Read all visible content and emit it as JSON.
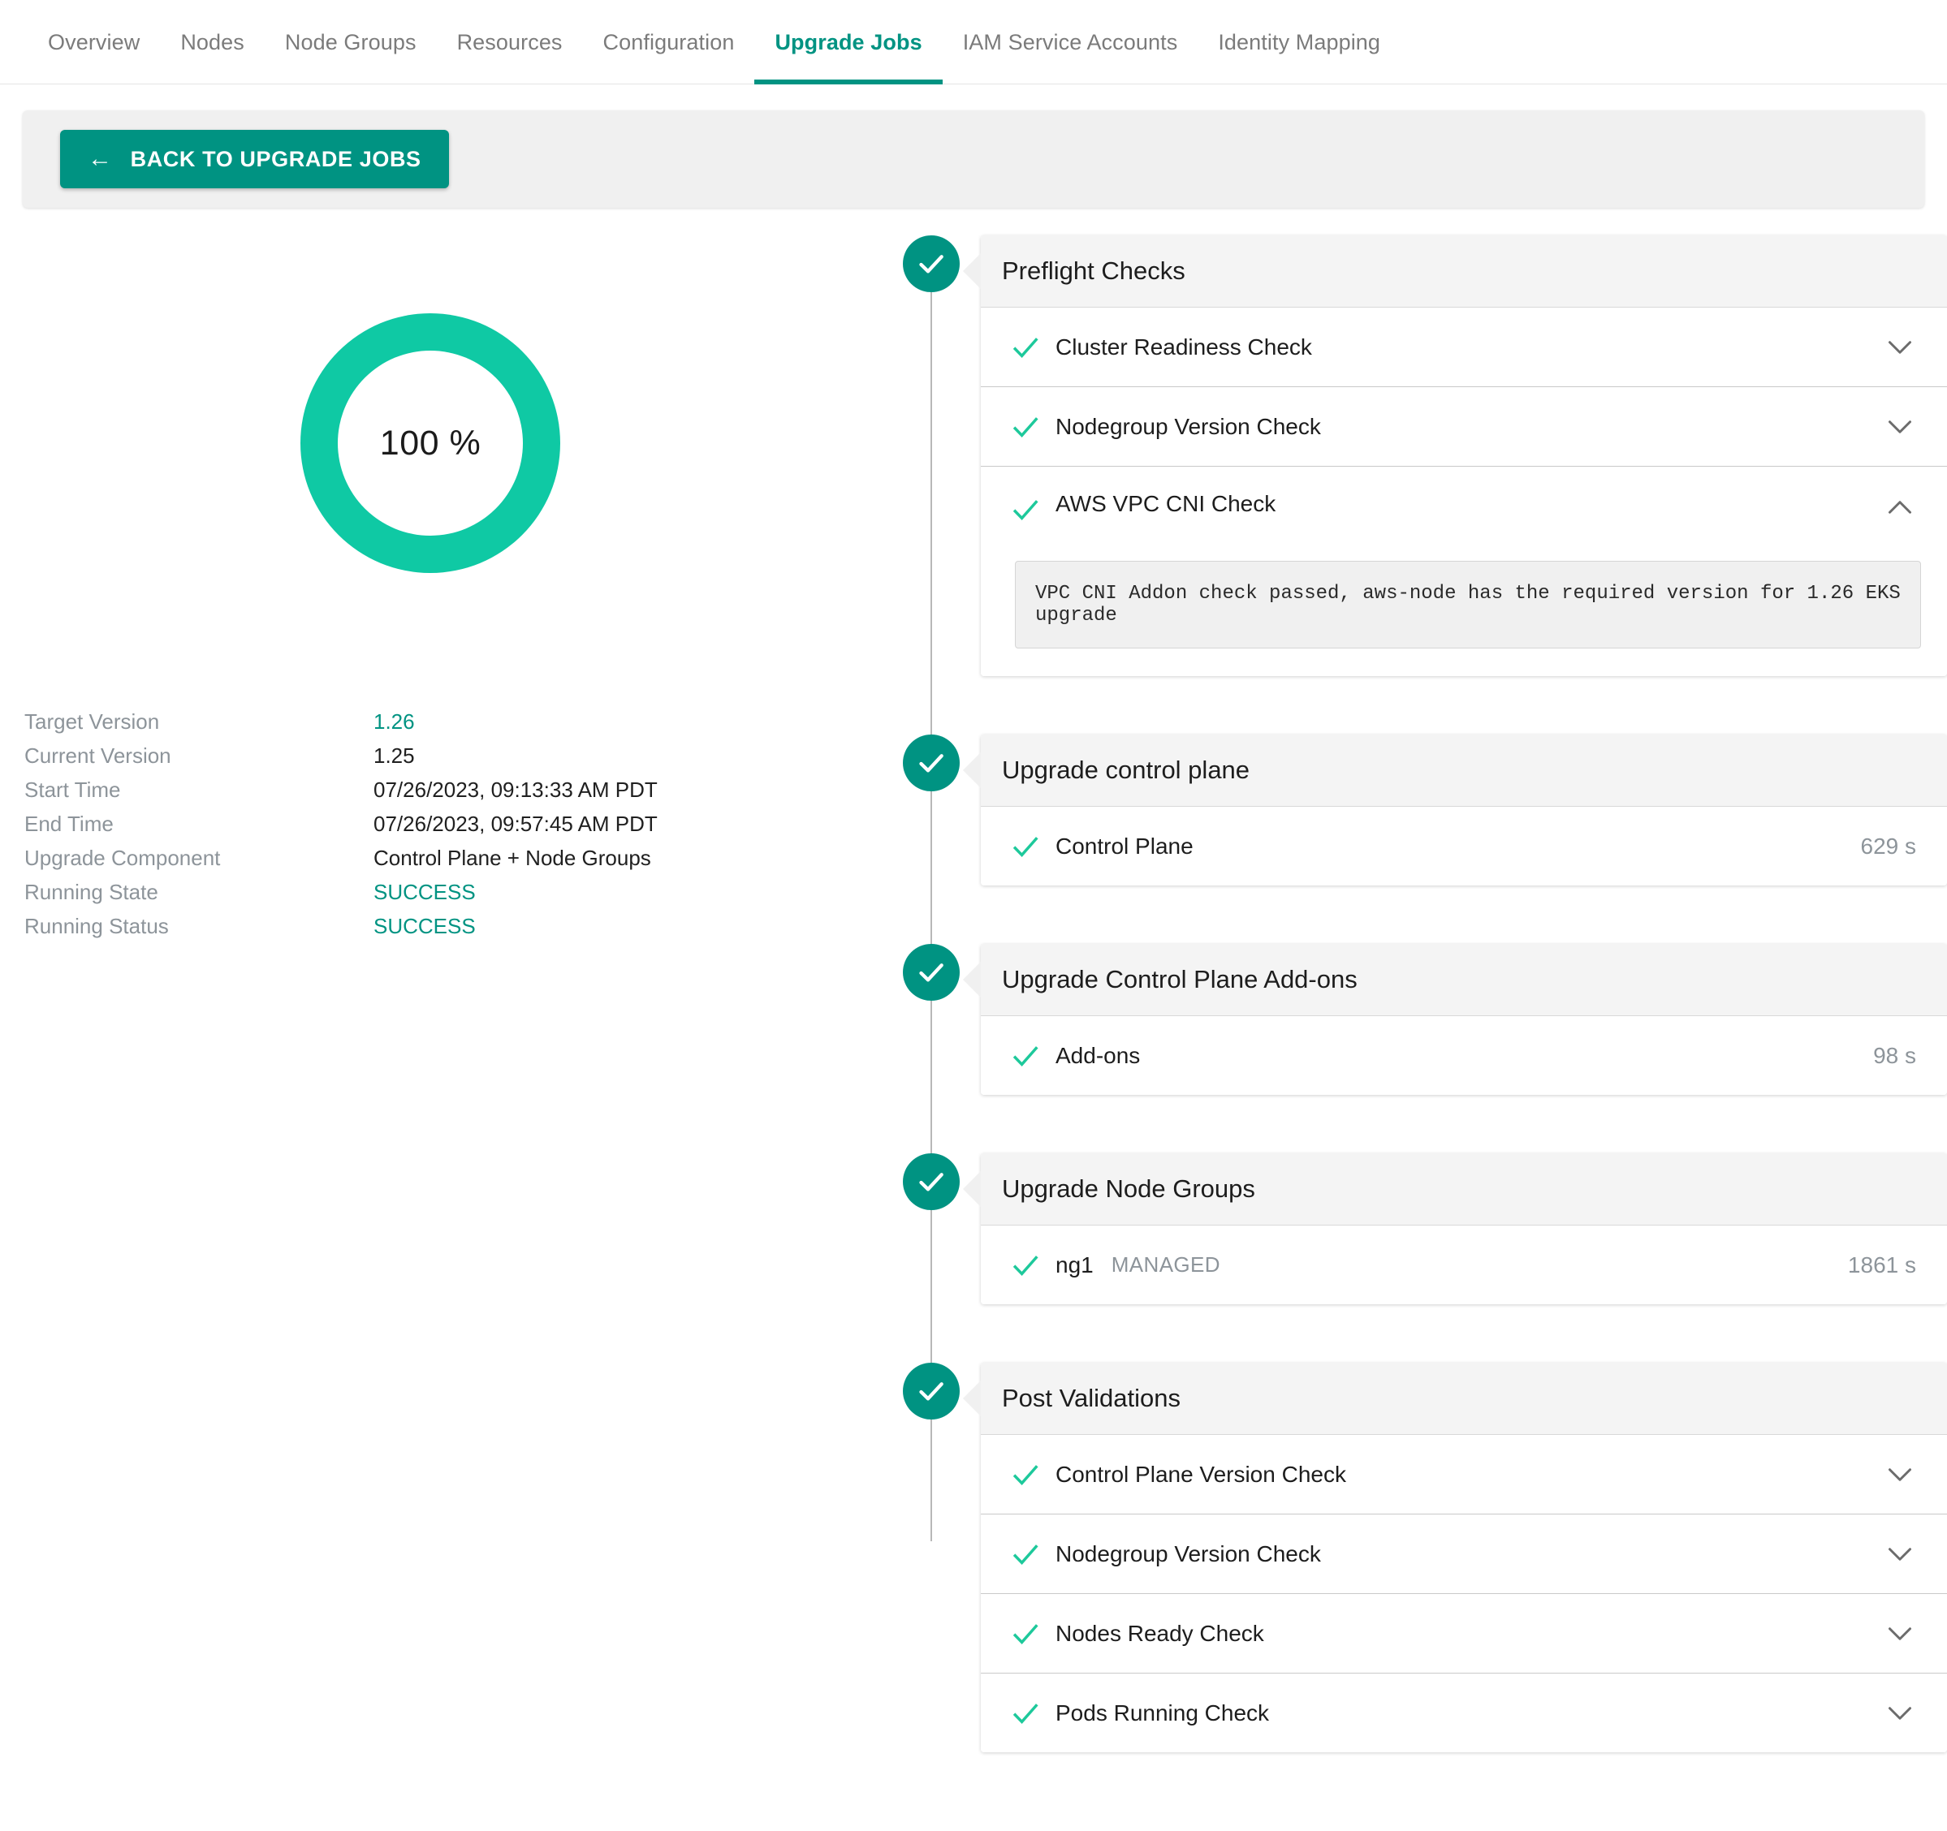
{
  "tabs": [
    {
      "label": "Overview",
      "active": false
    },
    {
      "label": "Nodes",
      "active": false
    },
    {
      "label": "Node Groups",
      "active": false
    },
    {
      "label": "Resources",
      "active": false
    },
    {
      "label": "Configuration",
      "active": false
    },
    {
      "label": "Upgrade Jobs",
      "active": true
    },
    {
      "label": "IAM Service Accounts",
      "active": false
    },
    {
      "label": "Identity Mapping",
      "active": false
    }
  ],
  "toolbar": {
    "back_label": "BACK TO UPGRADE JOBS",
    "back_arrow": "←"
  },
  "progress": {
    "percent_label": "100 %",
    "percent_value": 100,
    "ring_color": "#0fc9a4"
  },
  "details": {
    "rows": [
      {
        "key": "Target Version",
        "value": "1.26",
        "accent": true
      },
      {
        "key": "Current Version",
        "value": "1.25",
        "accent": false
      },
      {
        "key": "Start Time",
        "value": "07/26/2023, 09:13:33 AM PDT",
        "accent": false
      },
      {
        "key": "End Time",
        "value": "07/26/2023, 09:57:45 AM PDT",
        "accent": false
      },
      {
        "key": "Upgrade Component",
        "value": "Control Plane + Node Groups",
        "accent": false
      },
      {
        "key": "Running State",
        "value": "SUCCESS",
        "accent": true
      },
      {
        "key": "Running Status",
        "value": "SUCCESS",
        "accent": true
      }
    ]
  },
  "colors": {
    "brand_dark": "#009382",
    "brand_bright": "#0fc9a4",
    "check_green": "#1dc99b",
    "muted_text": "#8d949a"
  },
  "timeline": {
    "stages": [
      {
        "title": "Preflight Checks",
        "status_icon": "check-circle-icon",
        "rows": [
          {
            "label": "Cluster Readiness Check",
            "icon": "check-icon",
            "expanded": false,
            "chevron": "chevron-down-icon"
          },
          {
            "label": "Nodegroup Version Check",
            "icon": "check-icon",
            "expanded": false,
            "chevron": "chevron-down-icon"
          },
          {
            "label": "AWS VPC CNI Check",
            "icon": "check-icon",
            "expanded": true,
            "chevron": "chevron-up-icon",
            "detail": "VPC CNI Addon check passed, aws-node has the required version for 1.26 EKS upgrade"
          }
        ]
      },
      {
        "title": "Upgrade control plane",
        "status_icon": "check-circle-icon",
        "rows": [
          {
            "label": "Control Plane",
            "icon": "check-icon",
            "duration": "629 s"
          }
        ]
      },
      {
        "title": "Upgrade Control Plane Add-ons",
        "status_icon": "check-circle-icon",
        "rows": [
          {
            "label": "Add-ons",
            "icon": "check-icon",
            "duration": "98 s"
          }
        ]
      },
      {
        "title": "Upgrade Node Groups",
        "status_icon": "check-circle-icon",
        "rows": [
          {
            "label": "ng1",
            "tag": "MANAGED",
            "icon": "check-icon",
            "duration": "1861 s"
          }
        ]
      },
      {
        "title": "Post Validations",
        "status_icon": "check-circle-icon",
        "rows": [
          {
            "label": "Control Plane Version Check",
            "icon": "check-icon",
            "expanded": false,
            "chevron": "chevron-down-icon"
          },
          {
            "label": "Nodegroup Version Check",
            "icon": "check-icon",
            "expanded": false,
            "chevron": "chevron-down-icon"
          },
          {
            "label": "Nodes Ready Check",
            "icon": "check-icon",
            "expanded": false,
            "chevron": "chevron-down-icon"
          },
          {
            "label": "Pods Running Check",
            "icon": "check-icon",
            "expanded": false,
            "chevron": "chevron-down-icon"
          }
        ]
      }
    ]
  }
}
